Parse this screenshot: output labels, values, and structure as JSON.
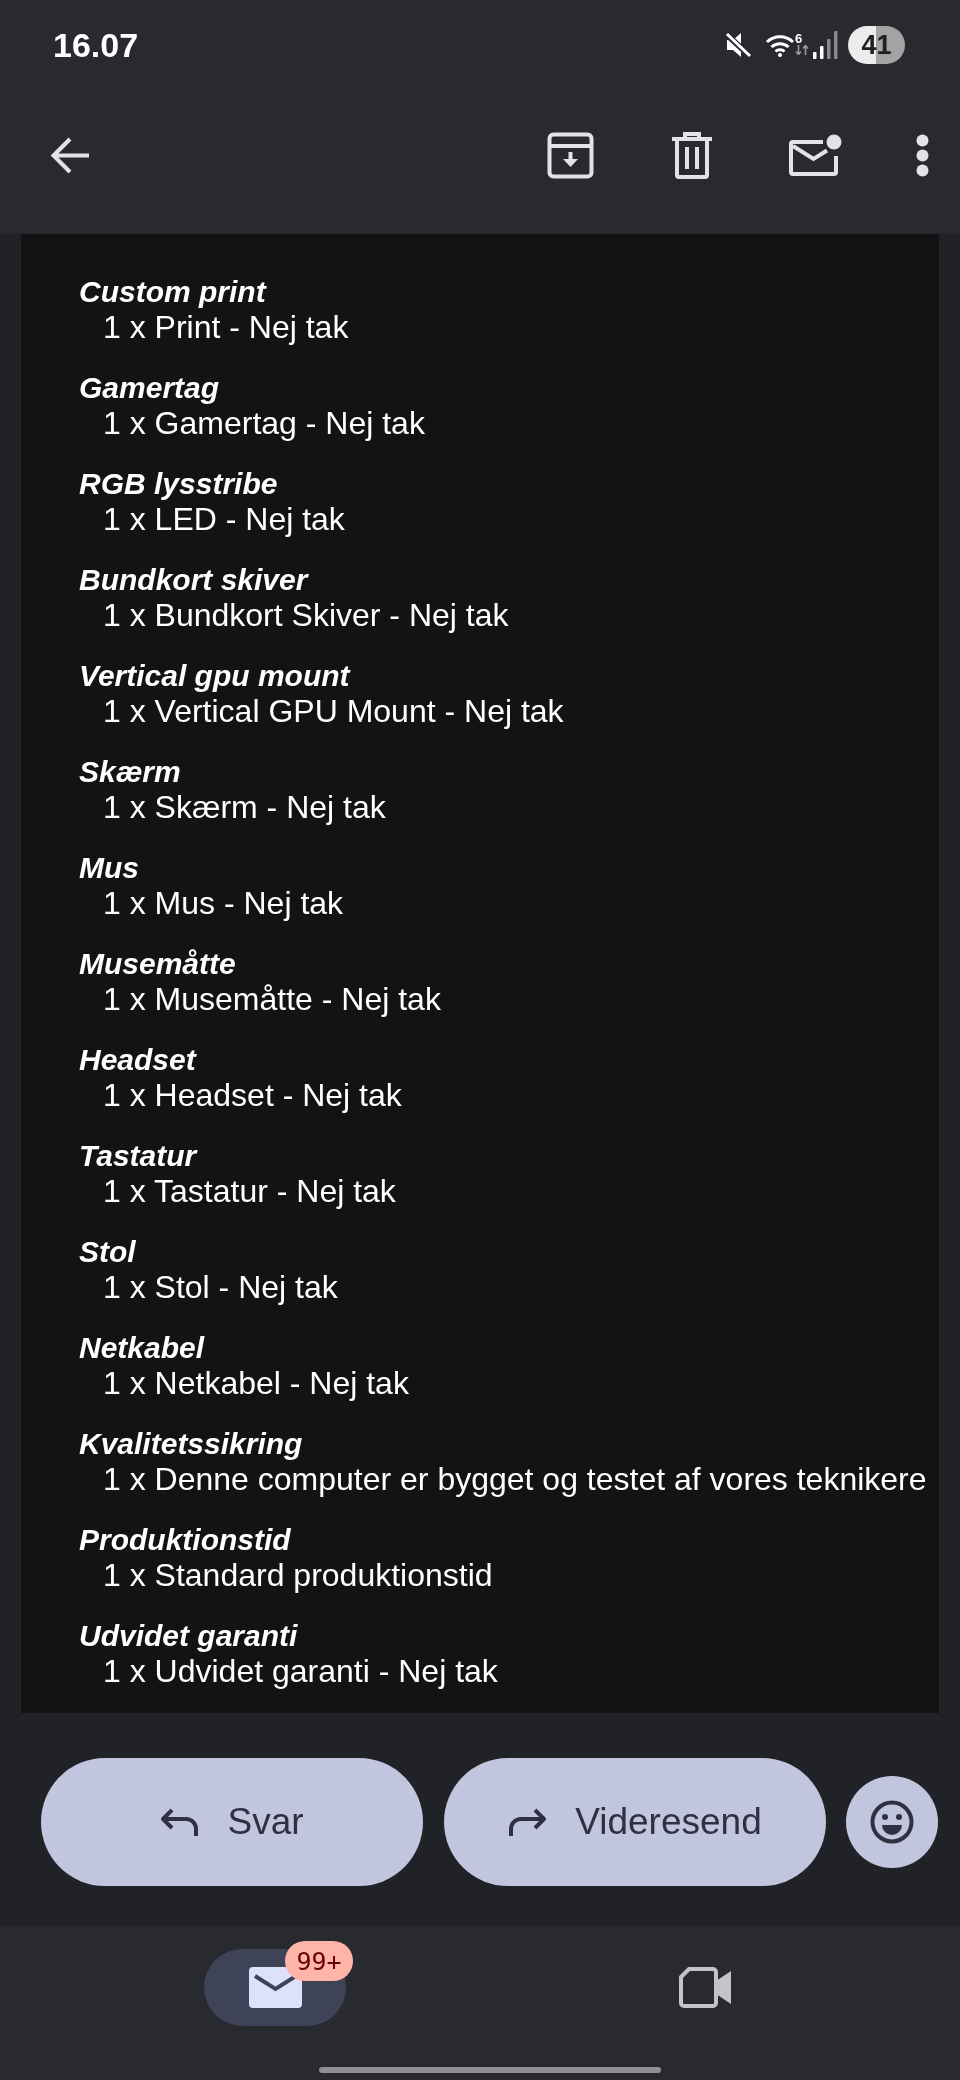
{
  "status_bar": {
    "time": "16.07",
    "wifi_standard": "6",
    "battery": "41"
  },
  "message": {
    "options": [
      {
        "heading": "Custom print",
        "value": "1 x Print - Nej tak"
      },
      {
        "heading": "Gamertag",
        "value": "1 x Gamertag - Nej tak"
      },
      {
        "heading": "RGB lysstribe",
        "value": "1 x LED - Nej tak"
      },
      {
        "heading": "Bundkort skiver",
        "value": "1 x Bundkort Skiver - Nej tak"
      },
      {
        "heading": "Vertical gpu mount",
        "value": "1 x Vertical GPU Mount - Nej tak"
      },
      {
        "heading": "Skærm",
        "value": "1 x Skærm - Nej tak"
      },
      {
        "heading": "Mus",
        "value": "1 x Mus - Nej tak"
      },
      {
        "heading": "Musemåtte",
        "value": "1 x Musemåtte - Nej tak"
      },
      {
        "heading": "Headset",
        "value": "1 x Headset - Nej tak"
      },
      {
        "heading": "Tastatur",
        "value": "1 x Tastatur - Nej tak"
      },
      {
        "heading": "Stol",
        "value": "1 x Stol - Nej tak"
      },
      {
        "heading": "Netkabel",
        "value": "1 x Netkabel - Nej tak"
      },
      {
        "heading": "Kvalitetssikring",
        "value": "1 x Denne computer er bygget og testet af vores teknikere"
      },
      {
        "heading": "Produktionstid",
        "value": "1 x Standard produktionstid"
      },
      {
        "heading": "Udvidet garanti",
        "value": "1 x Udvidet garanti - Nej tak"
      }
    ]
  },
  "actions": [
    {
      "kind": "reply",
      "label": "Svar"
    },
    {
      "kind": "forward",
      "label": "Videresend"
    }
  ],
  "nav": [
    {
      "kind": "mail",
      "badge": "99+",
      "selected": true
    },
    {
      "kind": "video",
      "selected": false
    }
  ]
}
